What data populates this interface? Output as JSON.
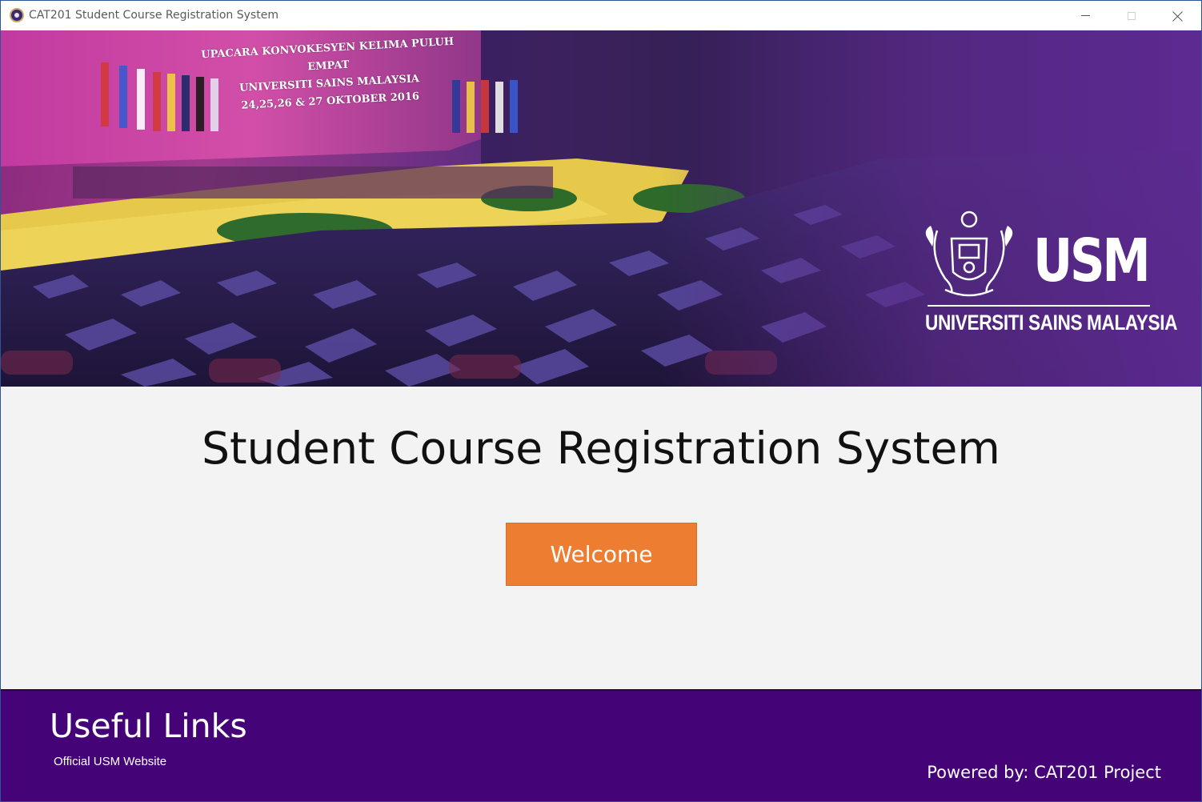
{
  "window": {
    "title": "CAT201 Student Course Registration System",
    "icon": "usm-crest-icon",
    "controls": {
      "minimize": "minimize-icon",
      "maximize": "maximize-icon",
      "close": "close-icon"
    }
  },
  "banner": {
    "photo_caption_lines": [
      "UPACARA KONVOKESYEN KELIMA PULUH EMPAT",
      "UNIVERSITI SAINS MALAYSIA",
      "24,25,26 & 27 OKTOBER 2016"
    ],
    "logo": {
      "letters": "USM",
      "name": "UNIVERSITI SAINS MALAYSIA"
    }
  },
  "main": {
    "title": "Student Course Registration System",
    "welcome_button": "Welcome"
  },
  "footer": {
    "heading": "Useful Links",
    "link": "Official USM Website",
    "powered_by": "Powered by: CAT201 Project"
  },
  "colors": {
    "accent_button": "#ed7d31",
    "footer_bg": "#440478",
    "page_bg": "#f3f3f3"
  }
}
